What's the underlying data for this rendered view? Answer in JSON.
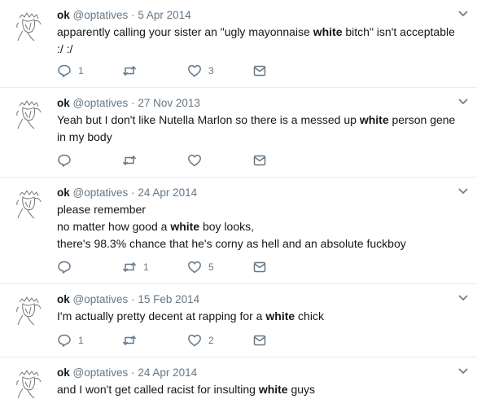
{
  "tweets": [
    {
      "name": "ok",
      "handle": "@optatives",
      "dot": "·",
      "date": "5 Apr 2014",
      "text_parts": [
        "apparently calling your sister an \"ugly mayonnaise ",
        "white",
        " bitch\" isn't acceptable :/ :/"
      ],
      "reply_count": "1",
      "retweet_count": "",
      "like_count": "3"
    },
    {
      "name": "ok",
      "handle": "@optatives",
      "dot": "·",
      "date": "27 Nov 2013",
      "text_parts": [
        "Yeah but I don't like Nutella Marlon so there is a messed up ",
        "white",
        " person gene in my body"
      ],
      "reply_count": "",
      "retweet_count": "",
      "like_count": ""
    },
    {
      "name": "ok",
      "handle": "@optatives",
      "dot": "·",
      "date": "24 Apr 2014",
      "lines": [
        [
          "please remember"
        ],
        [
          "no matter how good a ",
          "white",
          " boy looks,"
        ],
        [
          "there's 98.3% chance that he's corny as hell and an absolute fuckboy"
        ]
      ],
      "reply_count": "",
      "retweet_count": "1",
      "like_count": "5"
    },
    {
      "name": "ok",
      "handle": "@optatives",
      "dot": "·",
      "date": "15 Feb 2014",
      "text_parts": [
        "I'm actually pretty decent at rapping for a ",
        "white",
        " chick"
      ],
      "reply_count": "1",
      "retweet_count": "",
      "like_count": "2"
    },
    {
      "name": "ok",
      "handle": "@optatives",
      "dot": "·",
      "date": "24 Apr 2014",
      "text_parts": [
        "and I won't get called racist for insulting ",
        "white",
        " guys"
      ]
    }
  ],
  "icons": {
    "reply": "reply-icon",
    "retweet": "retweet-icon",
    "like": "heart-icon",
    "dm": "envelope-icon",
    "caret": "chevron-down-icon"
  },
  "colors": {
    "icon": "#657786",
    "border": "#e6ecf0",
    "text": "#14171a"
  }
}
